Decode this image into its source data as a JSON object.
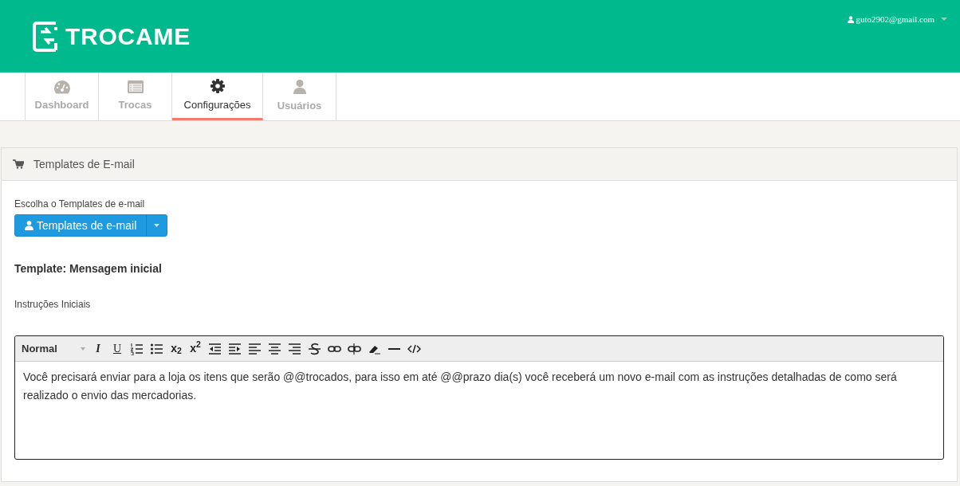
{
  "header": {
    "logo": "TROCAME",
    "user": "guto2902@gmail.com"
  },
  "tabs": [
    {
      "label": "Dashboard",
      "selected": false
    },
    {
      "label": "Trocas",
      "selected": false
    },
    {
      "label": "Configurações",
      "selected": true
    },
    {
      "label": "Usuários",
      "selected": false
    }
  ],
  "panel": {
    "title": "Templates de E-mail",
    "choose_label": "Escolha o Templates de e-mail",
    "dropdown_button": "Templates de e-mail",
    "template_title": "Template: Mensagem inicial",
    "field_label": "Instruções Iniciais",
    "editor": {
      "format": "Normal",
      "tools": [
        {
          "kind": "italic",
          "label": "I"
        },
        {
          "kind": "underline",
          "label": "U"
        },
        {
          "kind": "ol"
        },
        {
          "kind": "ul"
        },
        {
          "kind": "subscript",
          "label": "x$_{2}$"
        },
        {
          "kind": "superscript",
          "label": "x$^{2}$"
        },
        {
          "kind": "outdent"
        },
        {
          "kind": "indent"
        },
        {
          "kind": "left"
        },
        {
          "kind": "center"
        },
        {
          "kind": "right"
        },
        {
          "kind": "strike"
        },
        {
          "kind": "link"
        },
        {
          "kind": "unlink"
        },
        {
          "kind": "eraser"
        },
        {
          "kind": "hr"
        },
        {
          "kind": "code"
        }
      ],
      "content": "Você precisará enviar para a loja os itens que serão @@trocados, para isso em até @@prazo dia(s) você receberá um novo e-mail com as instruções detalhadas de como será realizado o envio das mercadorias."
    }
  }
}
